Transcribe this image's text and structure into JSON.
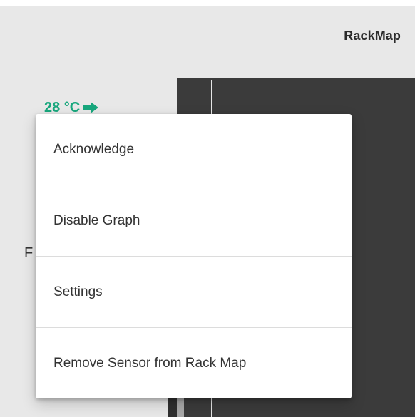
{
  "header": {
    "title": "RackMap"
  },
  "sensor": {
    "temperature": "28 °C",
    "arrow_icon": "arrow-right-icon",
    "accent_color": "#18a77d"
  },
  "partial_label": "F",
  "context_menu": {
    "items": [
      {
        "label": "Acknowledge"
      },
      {
        "label": "Disable Graph"
      },
      {
        "label": "Settings"
      },
      {
        "label": "Remove Sensor from Rack Map"
      }
    ]
  }
}
